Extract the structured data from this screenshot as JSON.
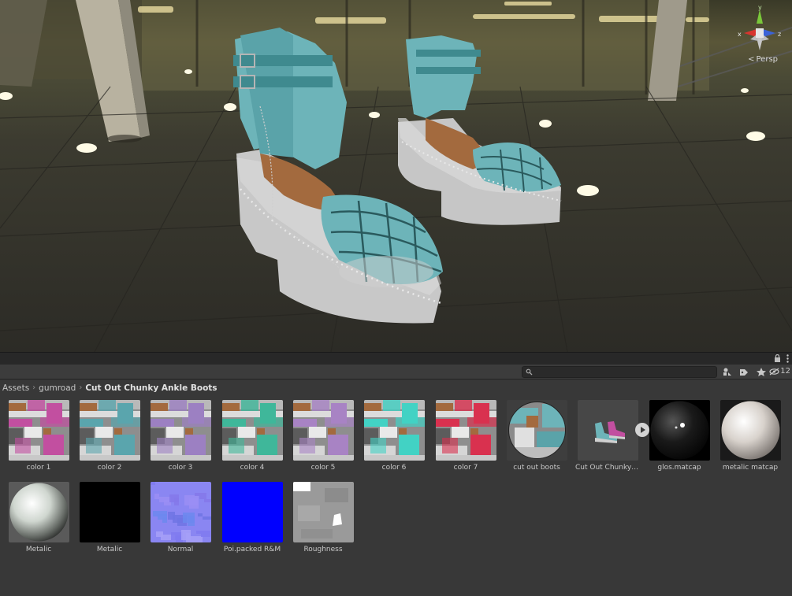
{
  "scene": {
    "projection": "Persp",
    "gizmo": {
      "x": "x",
      "y": "y",
      "z": "z"
    }
  },
  "toolbar": {
    "search_placeholder": "",
    "hidden_count": "12"
  },
  "breadcrumb": [
    "Assets",
    "gumroad",
    "Cut Out Chunky Ankle Boots"
  ],
  "assets": [
    {
      "label": "color 1",
      "kind": "texture",
      "tint": "#c24fa0"
    },
    {
      "label": "color 2",
      "kind": "texture",
      "tint": "#5aa5ad"
    },
    {
      "label": "color 3",
      "kind": "texture",
      "tint": "#9c80c2"
    },
    {
      "label": "color 4",
      "kind": "texture",
      "tint": "#3fb79a"
    },
    {
      "label": "color 5",
      "kind": "texture",
      "tint": "#a883c4"
    },
    {
      "label": "color 6",
      "kind": "texture",
      "tint": "#42d2c4"
    },
    {
      "label": "color 7",
      "kind": "texture",
      "tint": "#d9314f"
    },
    {
      "label": "cut out boots",
      "kind": "material"
    },
    {
      "label": "Cut Out Chunky ...",
      "kind": "prefab"
    },
    {
      "label": "glos.matcap",
      "kind": "matcap-dark"
    },
    {
      "label": "metalic matcap",
      "kind": "matcap-pearl"
    },
    {
      "label": "Metalic",
      "kind": "matcap-metal"
    },
    {
      "label": "Metalic",
      "kind": "black"
    },
    {
      "label": "Normal",
      "kind": "normal"
    },
    {
      "label": "Poi.packed R&M",
      "kind": "blue"
    },
    {
      "label": "Roughness",
      "kind": "roughness"
    }
  ],
  "colors": {
    "boot_leather": "#6db4b9",
    "sole": "#c9c9c9",
    "insole": "#a36a3e",
    "panel_bg": "#383838"
  }
}
